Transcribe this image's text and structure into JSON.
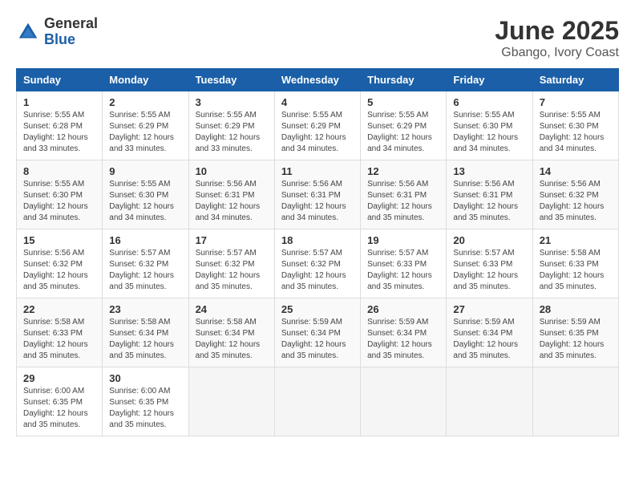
{
  "logo": {
    "general": "General",
    "blue": "Blue"
  },
  "title": "June 2025",
  "subtitle": "Gbango, Ivory Coast",
  "headers": [
    "Sunday",
    "Monday",
    "Tuesday",
    "Wednesday",
    "Thursday",
    "Friday",
    "Saturday"
  ],
  "weeks": [
    [
      {
        "day": "1",
        "info": "Sunrise: 5:55 AM\nSunset: 6:28 PM\nDaylight: 12 hours\nand 33 minutes."
      },
      {
        "day": "2",
        "info": "Sunrise: 5:55 AM\nSunset: 6:29 PM\nDaylight: 12 hours\nand 33 minutes."
      },
      {
        "day": "3",
        "info": "Sunrise: 5:55 AM\nSunset: 6:29 PM\nDaylight: 12 hours\nand 33 minutes."
      },
      {
        "day": "4",
        "info": "Sunrise: 5:55 AM\nSunset: 6:29 PM\nDaylight: 12 hours\nand 34 minutes."
      },
      {
        "day": "5",
        "info": "Sunrise: 5:55 AM\nSunset: 6:29 PM\nDaylight: 12 hours\nand 34 minutes."
      },
      {
        "day": "6",
        "info": "Sunrise: 5:55 AM\nSunset: 6:30 PM\nDaylight: 12 hours\nand 34 minutes."
      },
      {
        "day": "7",
        "info": "Sunrise: 5:55 AM\nSunset: 6:30 PM\nDaylight: 12 hours\nand 34 minutes."
      }
    ],
    [
      {
        "day": "8",
        "info": "Sunrise: 5:55 AM\nSunset: 6:30 PM\nDaylight: 12 hours\nand 34 minutes."
      },
      {
        "day": "9",
        "info": "Sunrise: 5:55 AM\nSunset: 6:30 PM\nDaylight: 12 hours\nand 34 minutes."
      },
      {
        "day": "10",
        "info": "Sunrise: 5:56 AM\nSunset: 6:31 PM\nDaylight: 12 hours\nand 34 minutes."
      },
      {
        "day": "11",
        "info": "Sunrise: 5:56 AM\nSunset: 6:31 PM\nDaylight: 12 hours\nand 34 minutes."
      },
      {
        "day": "12",
        "info": "Sunrise: 5:56 AM\nSunset: 6:31 PM\nDaylight: 12 hours\nand 35 minutes."
      },
      {
        "day": "13",
        "info": "Sunrise: 5:56 AM\nSunset: 6:31 PM\nDaylight: 12 hours\nand 35 minutes."
      },
      {
        "day": "14",
        "info": "Sunrise: 5:56 AM\nSunset: 6:32 PM\nDaylight: 12 hours\nand 35 minutes."
      }
    ],
    [
      {
        "day": "15",
        "info": "Sunrise: 5:56 AM\nSunset: 6:32 PM\nDaylight: 12 hours\nand 35 minutes."
      },
      {
        "day": "16",
        "info": "Sunrise: 5:57 AM\nSunset: 6:32 PM\nDaylight: 12 hours\nand 35 minutes."
      },
      {
        "day": "17",
        "info": "Sunrise: 5:57 AM\nSunset: 6:32 PM\nDaylight: 12 hours\nand 35 minutes."
      },
      {
        "day": "18",
        "info": "Sunrise: 5:57 AM\nSunset: 6:32 PM\nDaylight: 12 hours\nand 35 minutes."
      },
      {
        "day": "19",
        "info": "Sunrise: 5:57 AM\nSunset: 6:33 PM\nDaylight: 12 hours\nand 35 minutes."
      },
      {
        "day": "20",
        "info": "Sunrise: 5:57 AM\nSunset: 6:33 PM\nDaylight: 12 hours\nand 35 minutes."
      },
      {
        "day": "21",
        "info": "Sunrise: 5:58 AM\nSunset: 6:33 PM\nDaylight: 12 hours\nand 35 minutes."
      }
    ],
    [
      {
        "day": "22",
        "info": "Sunrise: 5:58 AM\nSunset: 6:33 PM\nDaylight: 12 hours\nand 35 minutes."
      },
      {
        "day": "23",
        "info": "Sunrise: 5:58 AM\nSunset: 6:34 PM\nDaylight: 12 hours\nand 35 minutes."
      },
      {
        "day": "24",
        "info": "Sunrise: 5:58 AM\nSunset: 6:34 PM\nDaylight: 12 hours\nand 35 minutes."
      },
      {
        "day": "25",
        "info": "Sunrise: 5:59 AM\nSunset: 6:34 PM\nDaylight: 12 hours\nand 35 minutes."
      },
      {
        "day": "26",
        "info": "Sunrise: 5:59 AM\nSunset: 6:34 PM\nDaylight: 12 hours\nand 35 minutes."
      },
      {
        "day": "27",
        "info": "Sunrise: 5:59 AM\nSunset: 6:34 PM\nDaylight: 12 hours\nand 35 minutes."
      },
      {
        "day": "28",
        "info": "Sunrise: 5:59 AM\nSunset: 6:35 PM\nDaylight: 12 hours\nand 35 minutes."
      }
    ],
    [
      {
        "day": "29",
        "info": "Sunrise: 6:00 AM\nSunset: 6:35 PM\nDaylight: 12 hours\nand 35 minutes."
      },
      {
        "day": "30",
        "info": "Sunrise: 6:00 AM\nSunset: 6:35 PM\nDaylight: 12 hours\nand 35 minutes."
      },
      {
        "day": "",
        "info": ""
      },
      {
        "day": "",
        "info": ""
      },
      {
        "day": "",
        "info": ""
      },
      {
        "day": "",
        "info": ""
      },
      {
        "day": "",
        "info": ""
      }
    ]
  ]
}
